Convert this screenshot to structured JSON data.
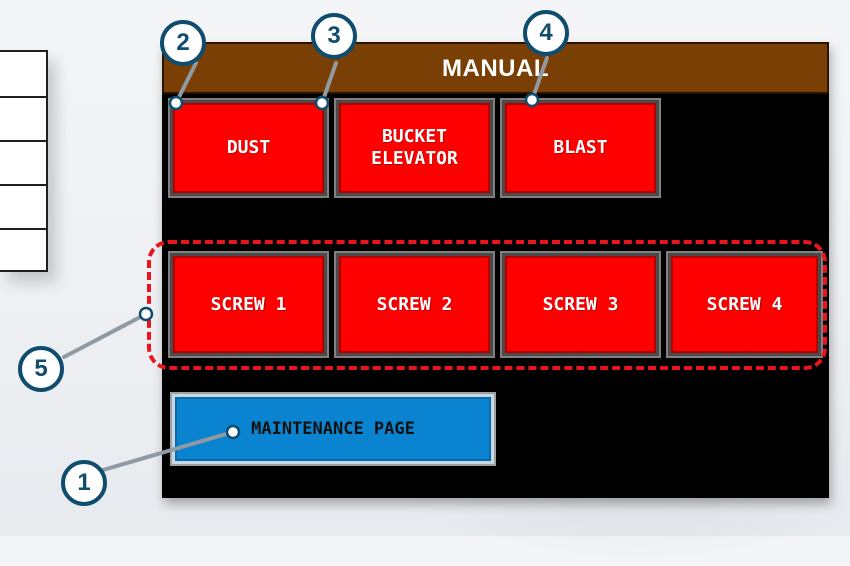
{
  "screen": {
    "title": "MANUAL"
  },
  "buttons": {
    "dust": "DUST",
    "bucket_elevator": "BUCKET\nELEVATOR",
    "blast": "BLAST",
    "screw_1": "SCREW 1",
    "screw_2": "SCREW 2",
    "screw_3": "SCREW 3",
    "screw_4": "SCREW 4",
    "maintenance": "MAINTENANCE PAGE"
  },
  "callouts": {
    "one": "1",
    "two": "2",
    "three": "3",
    "four": "4",
    "five": "5"
  },
  "colors": {
    "title_bar": "#7a3f05",
    "button_red": "#ff0000",
    "maintenance_blue": "#0a84d0",
    "callout_outline": "#0f4c6e",
    "group_dash": "#e9151d",
    "screen_background": "#000000"
  }
}
